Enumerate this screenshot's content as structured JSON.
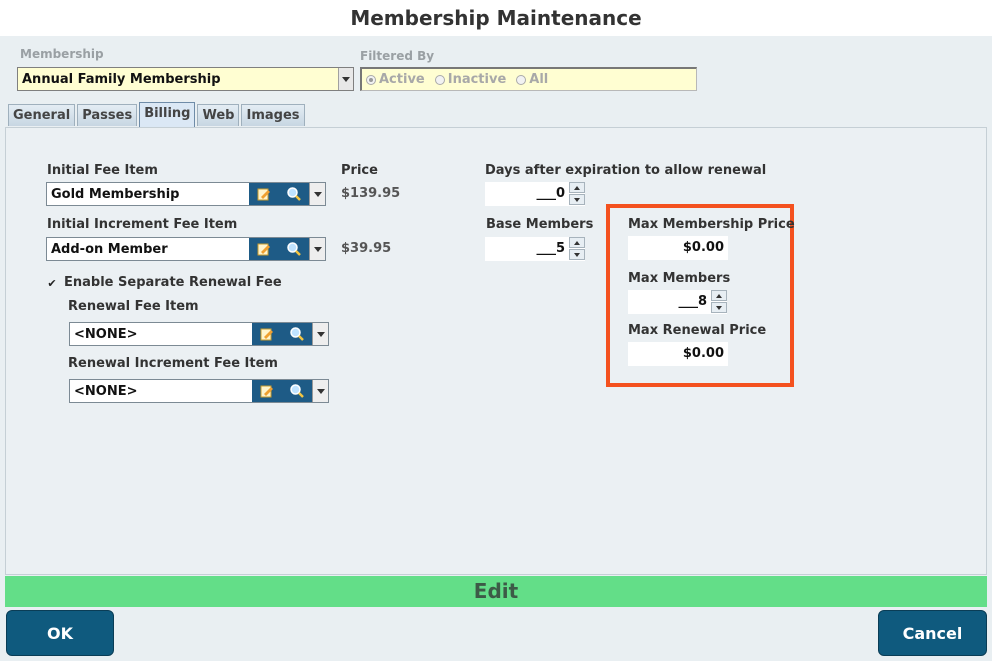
{
  "window": {
    "title": "Membership Maintenance"
  },
  "header": {
    "membership_label": "Membership",
    "membership_value": "Annual Family Membership",
    "filtered_by_label": "Filtered By",
    "filters": [
      {
        "label": "Active",
        "selected": true
      },
      {
        "label": "Inactive",
        "selected": false
      },
      {
        "label": "All",
        "selected": false
      }
    ]
  },
  "tabs": [
    {
      "label": "General",
      "active": false
    },
    {
      "label": "Passes",
      "active": false
    },
    {
      "label": "Billing",
      "active": true
    },
    {
      "label": "Web",
      "active": false
    },
    {
      "label": "Images",
      "active": false
    }
  ],
  "billing": {
    "initial_fee_label": "Initial Fee Item",
    "initial_fee_value": "Gold Membership",
    "price_label": "Price",
    "initial_fee_price": "$139.95",
    "increment_fee_label": "Initial Increment Fee Item",
    "increment_fee_value": "Add-on Member",
    "increment_fee_price": "$39.95",
    "enable_renewal_label": "Enable Separate Renewal Fee",
    "enable_renewal_checked": true,
    "renewal_fee_label": "Renewal Fee Item",
    "renewal_fee_value": "<NONE>",
    "renewal_increment_label": "Renewal Increment Fee Item",
    "renewal_increment_value": "<NONE>",
    "days_after_label": "Days after expiration to allow renewal",
    "days_after_value": "___0",
    "base_members_label": "Base Members",
    "base_members_value": "___5",
    "max_price_label": "Max Membership Price",
    "max_price_value": "$0.00",
    "max_members_label": "Max Members",
    "max_members_value": "___8",
    "max_renewal_label": "Max Renewal Price",
    "max_renewal_value": "$0.00"
  },
  "edit_bar": {
    "label": "Edit"
  },
  "footer": {
    "ok_label": "OK",
    "cancel_label": "Cancel"
  },
  "colors": {
    "accent": "#0f5a7e",
    "edit_bar": "#63de88",
    "highlight": "#f4511e",
    "field_yellow": "#fffed2"
  }
}
